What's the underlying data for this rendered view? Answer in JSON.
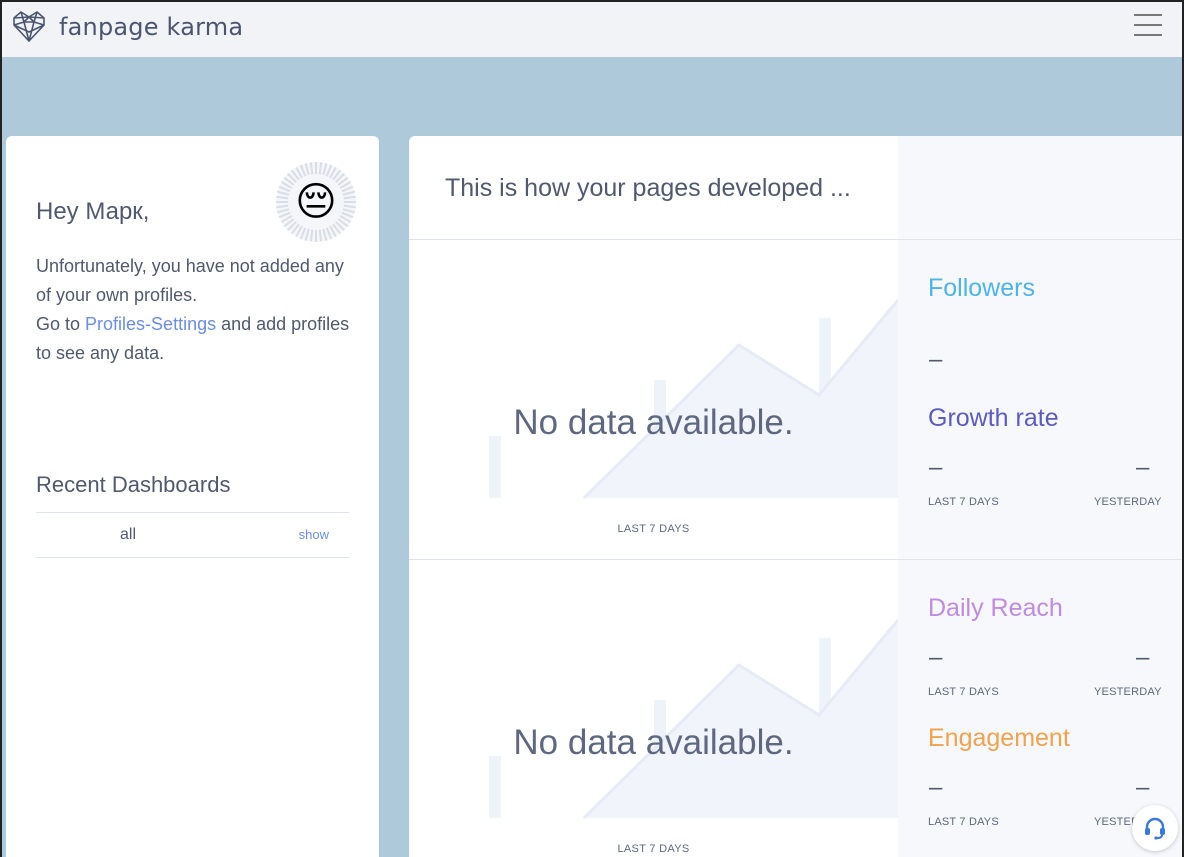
{
  "app": {
    "name": "fanpage karma"
  },
  "welcome": {
    "greeting": "Hey Марк,",
    "line1": "Unfortunately, you have not added any of your own profiles.",
    "line2_prefix": "Go to ",
    "line2_link": "Profiles-Settings",
    "line2_suffix": " and add profiles to see any data.",
    "emoji": "😔"
  },
  "recent": {
    "title": "Recent Dashboards",
    "items": [
      {
        "name": "all",
        "action": "show"
      }
    ]
  },
  "main": {
    "headline": "This is how your pages developed ...",
    "panels": [
      {
        "no_data": "No data available.",
        "period": "LAST 7 DAYS"
      },
      {
        "no_data": "No data available.",
        "period": "LAST 7 DAYS"
      }
    ],
    "metrics": {
      "followers": {
        "title": "Followers",
        "value": "–"
      },
      "growth": {
        "title": "Growth rate",
        "last7": "–",
        "yesterday": "–",
        "last7_label": "LAST 7 DAYS",
        "yesterday_label": "YESTERDAY"
      },
      "reach": {
        "title": "Daily Reach",
        "last7": "–",
        "yesterday": "–",
        "last7_label": "LAST 7 DAYS",
        "yesterday_label": "YESTERDAY"
      },
      "engagement": {
        "title": "Engagement",
        "last7": "–",
        "yesterday": "–",
        "last7_label": "LAST 7 DAYS",
        "yesterday_label": "YESTERDAY"
      }
    }
  },
  "colors": {
    "backdrop": "#aec9d9",
    "followers": "#4fb3e8",
    "growth": "#5b5bc4",
    "reach": "#c08be0",
    "engagement": "#f0a24f",
    "link": "#6b8de3"
  },
  "icons": {
    "logo": "heart-network-icon",
    "menu": "hamburger-menu-icon",
    "support": "headset-icon"
  }
}
